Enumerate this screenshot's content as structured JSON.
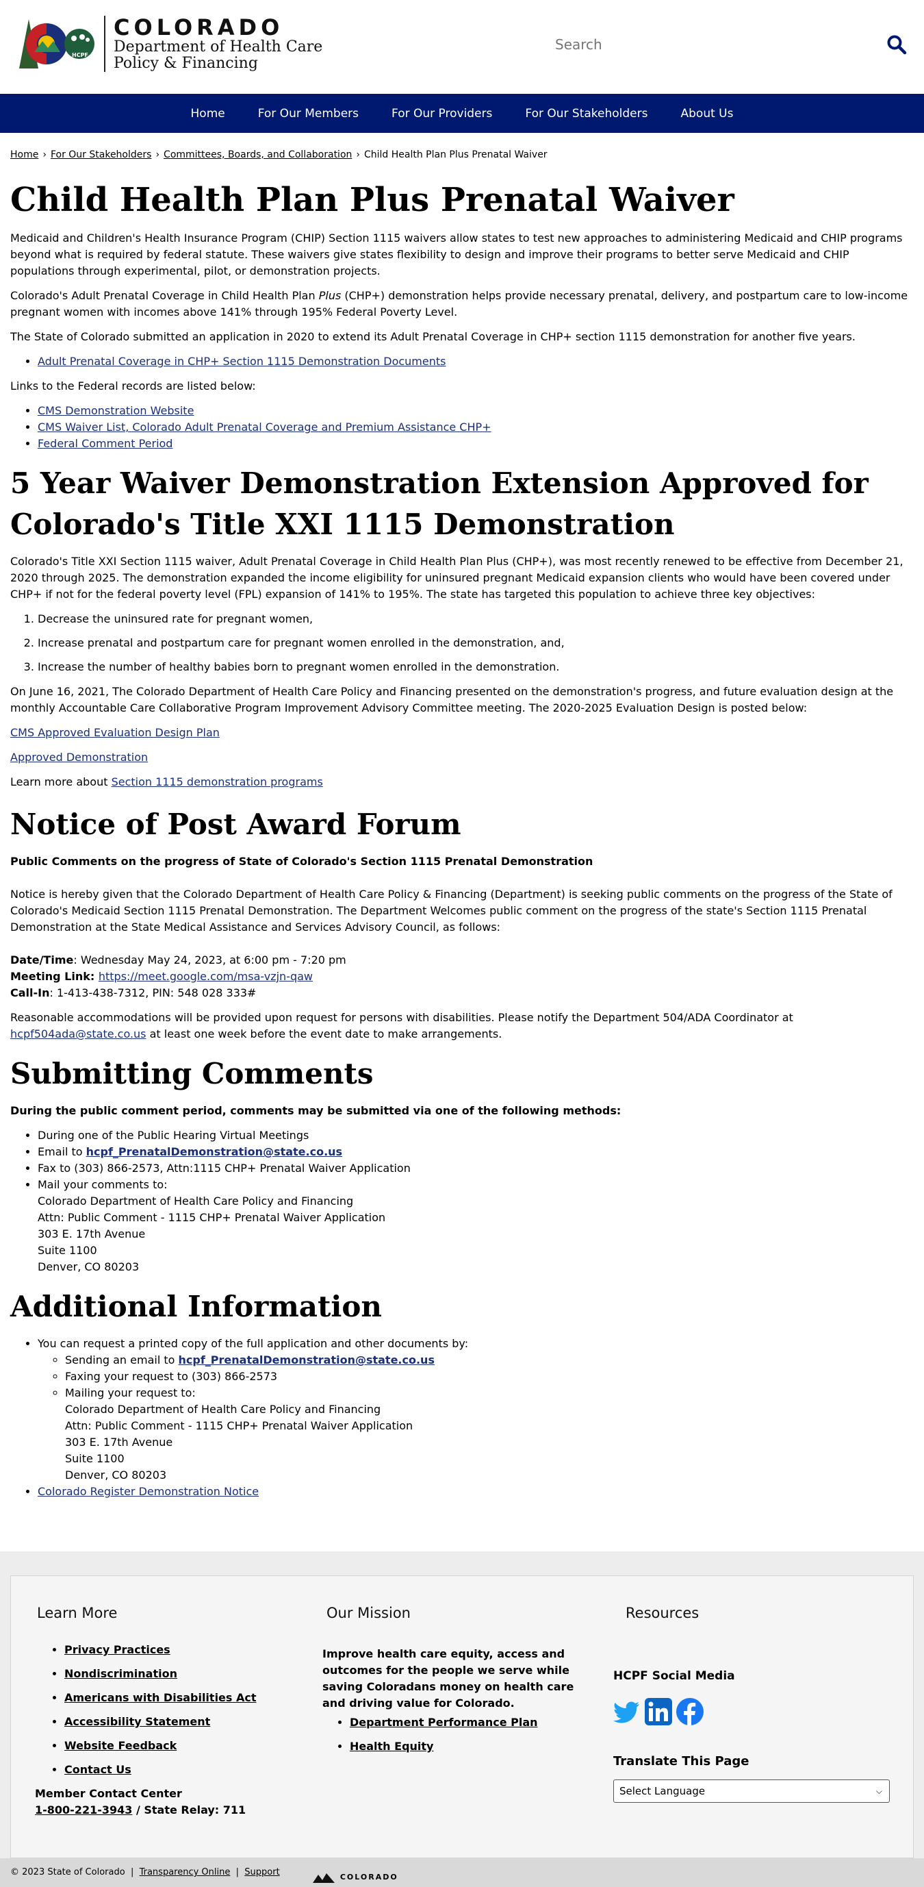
{
  "header": {
    "logo_state": "COLORADO",
    "logo_dept_line1": "Department of Health Care",
    "logo_dept_line2": "Policy & Financing",
    "logo_badge": "HCPF",
    "search_placeholder": "Search"
  },
  "nav": {
    "items": [
      "Home",
      "For Our Members",
      "For Our Providers",
      "For Our Stakeholders",
      "About Us"
    ]
  },
  "breadcrumb": {
    "items": [
      "Home",
      "For Our Stakeholders",
      "Committees, Boards, and Collaboration"
    ],
    "current": "Child Health Plan Plus Prenatal Waiver"
  },
  "page": {
    "title": "Child Health Plan Plus Prenatal Waiver",
    "intro_p1": "Medicaid and Children's Health Insurance Program (CHIP) Section 1115 waivers allow states to test new approaches to administering Medicaid and CHIP programs beyond what is required by federal statute. These waivers give states flexibility to design and improve their programs to better serve Medicaid and CHIP populations through experimental, pilot, or demonstration projects.",
    "intro_p2_a": "Colorado's Adult Prenatal Coverage in Child Health Plan ",
    "intro_p2_italic": "Plus",
    "intro_p2_b": " (CHP+) demonstration helps provide necessary prenatal, delivery, and postpartum care to low-income pregnant women with incomes above 141% through 195% Federal Poverty Level.",
    "intro_p3": "The State of Colorado submitted an application in 2020 to extend its Adult Prenatal Coverage in CHP+ section 1115 demonstration for another five years.",
    "doc_link": "Adult Prenatal Coverage in CHP+ Section 1115 Demonstration Documents",
    "federal_intro": "Links to the Federal records are listed below:",
    "federal_links": [
      "CMS Demonstration Website",
      "CMS Waiver List, Colorado Adult Prenatal Coverage and Premium Assistance CHP+",
      "Federal Comment Period"
    ]
  },
  "extension": {
    "heading": "5 Year Waiver Demonstration Extension Approved for Colorado's Title XXI 1115 Demonstration",
    "p1": "Colorado's Title XXI Section 1115 waiver, Adult Prenatal Coverage in Child Health Plan Plus (CHP+), was most recently renewed to be effective from December 21, 2020 through 2025. The demonstration expanded the income eligibility for uninsured pregnant Medicaid expansion clients who would have been covered under CHP+ if not for the federal poverty level (FPL) expansion of 141% to 195%. The state has targeted this population to achieve three key objectives:",
    "objectives": [
      "Decrease the uninsured rate for pregnant women,",
      "Increase prenatal and postpartum care for pregnant women enrolled in the demonstration, and,",
      "Increase the number of healthy babies born to pregnant women enrolled in the demonstration."
    ],
    "p2": "On June 16, 2021, The Colorado Department of Health Care Policy and Financing presented on the demonstration's progress, and future evaluation design at the monthly Accountable Care Collaborative Program Improvement Advisory Committee meeting. The 2020-2025 Evaluation Design is posted below:",
    "link1": "CMS Approved Evaluation Design Plan",
    "link2": "Approved Demonstration",
    "learn_more": "Learn more about ",
    "learn_more_link": "Section 1115 demonstration programs"
  },
  "forum": {
    "heading": "Notice of Post Award Forum",
    "subheading": "Public Comments on the progress of State of Colorado's Section 1115 Prenatal Demonstration",
    "p1": "Notice is hereby given that the Colorado Department of Health Care Policy & Financing (Department) is seeking public comments on the progress of the State of Colorado's Medicaid Section 1115 Prenatal Demonstration. The Department Welcomes public comment on the progress of the state's Section 1115 Prenatal Demonstration at the State Medical Assistance and Services Advisory Council, as follows:",
    "datetime_label": "Date/Time",
    "datetime_value": ": Wednesday May 24, 2023, at 6:00 pm - 7:20 pm",
    "meeting_label": "Meeting Link",
    "meeting_link": "https://meet.google.com/msa-vzjn-qaw",
    "callin_label": "Call-In",
    "callin_value": ": 1-413-438-7312, PIN: 548 028 333#",
    "accommodations_a": "Reasonable accommodations will be provided upon request for persons with disabilities. Please notify the Department 504/ADA Coordinator at ",
    "accommodations_email": "hcpf504ada@state.co.us",
    "accommodations_b": " at least one week before the event date to make arrangements."
  },
  "submitting": {
    "heading": "Submitting Comments",
    "intro": "During the public comment period, comments may be submitted via one of the following methods:",
    "item1": "During one of the Public Hearing Virtual Meetings",
    "item2_a": "Email to ",
    "item2_email": "hcpf_PrenatalDemonstration@state.co.us",
    "item3": "Fax to (303) 866-2573, Attn:1115 CHP+ Prenatal Waiver Application",
    "item4": "Mail your comments to:",
    "address": [
      "Colorado Department of Health Care Policy and Financing",
      "Attn: Public Comment - 1115 CHP+ Prenatal Waiver Application",
      "303 E. 17th Avenue",
      "Suite 1100",
      "Denver, CO 80203"
    ]
  },
  "additional": {
    "heading": "Additional Information",
    "item1": "You can request a printed copy of the full application and other documents by:",
    "sub1_a": "Sending an email to ",
    "sub1_email": "hcpf_PrenatalDemonstration@state.co.us",
    "sub2": "Faxing your request to (303) 866-2573",
    "sub3": "Mailing your request to:",
    "address": [
      "Colorado Department of Health Care Policy and Financing",
      "Attn: Public Comment - 1115 CHP+ Prenatal Waiver Application",
      "303 E. 17th Avenue",
      "Suite 1100",
      "Denver, CO 80203"
    ],
    "item2": "Colorado Register Demonstration Notice"
  },
  "footer": {
    "learn_more_heading": "Learn More",
    "learn_more_links": [
      "Privacy Practices",
      "Nondiscrimination",
      "Americans with Disabilities Act",
      "Accessibility Statement",
      "Website Feedback",
      "Contact Us"
    ],
    "contact_label": "Member Contact Center",
    "contact_phone": "1-800-221-3943",
    "contact_relay": " / State Relay: 711",
    "mission_heading": "Our Mission",
    "mission_text": "Improve health care equity, access and outcomes for the people we serve while saving Coloradans money on health care and driving value for Colorado.",
    "mission_links": [
      "Department Performance Plan",
      "Health Equity"
    ],
    "resources_heading": "Resources",
    "social_heading": "HCPF Social Media",
    "translate_heading": "Translate This Page",
    "translate_select": "Select Language",
    "copyright": "© 2023 State of Colorado",
    "bottom_links": [
      "Transparency Online",
      "Support"
    ],
    "bottom_logo": "COLORADO"
  },
  "colors": {
    "nav_bg": "#001970",
    "link": "#1a2f7a",
    "footer_bg": "#f5f5f5"
  }
}
